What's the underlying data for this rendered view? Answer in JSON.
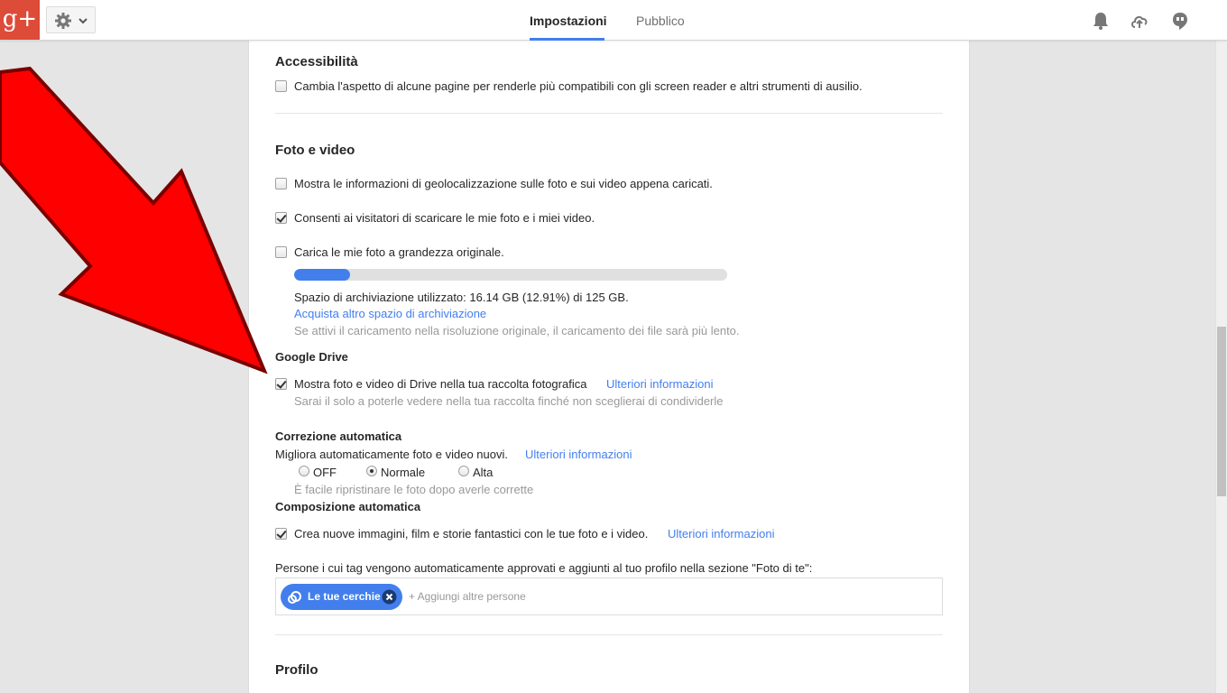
{
  "topbar": {
    "logo": "g+",
    "tabs": [
      {
        "label": "Impostazioni",
        "active": true
      },
      {
        "label": "Pubblico",
        "active": false
      }
    ],
    "icons": [
      "settings-gear-icon",
      "chevron-down-icon",
      "notifications-bell-icon",
      "share-cloud-icon",
      "hangouts-icon"
    ]
  },
  "accessibility": {
    "title": "Accessibilità",
    "option": {
      "label": "Cambia l'aspetto di alcune pagine per renderle più compatibili con gli screen reader e altri strumenti di ausilio.",
      "checked": false
    }
  },
  "photos": {
    "title": "Foto e video",
    "options": [
      {
        "label": "Mostra le informazioni di geolocalizzazione sulle foto e sui video appena caricati.",
        "checked": false
      },
      {
        "label": "Consenti ai visitatori di scaricare le mie foto e i miei video.",
        "checked": true
      },
      {
        "label": "Carica le mie foto a grandezza originale.",
        "checked": false
      }
    ],
    "storage": {
      "used_fraction": 0.1291,
      "text": "Spazio di archiviazione utilizzato: 16.14 GB (12.91%) di 125 GB.",
      "buy_link": "Acquista altro spazio di archiviazione",
      "note": "Se attivi il caricamento nella risoluzione originale, il caricamento dei file sarà più lento."
    }
  },
  "drive": {
    "title": "Google Drive",
    "option": {
      "label": "Mostra foto e video di Drive nella tua raccolta fotografica",
      "checked": true
    },
    "more_link": "Ulteriori informazioni",
    "note": "Sarai il solo a poterle vedere nella tua raccolta finché non sceglierai di condividerle"
  },
  "autofix": {
    "title": "Correzione automatica",
    "description": "Migliora automaticamente foto e video nuovi.",
    "more_link": "Ulteriori informazioni",
    "options": [
      {
        "label": "OFF",
        "selected": false
      },
      {
        "label": "Normale",
        "selected": true
      },
      {
        "label": "Alta",
        "selected": false
      }
    ],
    "note": "È facile ripristinare le foto dopo averle corrette"
  },
  "autoawesome": {
    "title": "Composizione automatica",
    "option": {
      "label": "Crea nuove immagini, film e storie fantastici con le tue foto e i video.",
      "checked": true
    },
    "more_link": "Ulteriori informazioni"
  },
  "tagging": {
    "label": "Persone i cui tag vengono automaticamente approvati e aggiunti al tuo profilo nella sezione \"Foto di te\":",
    "chip": "Le tue cerchie",
    "add_placeholder": "+ Aggiungi altre persone"
  },
  "profile": {
    "title": "Profilo"
  },
  "colors": {
    "brand_red": "#dd4b39",
    "accent_blue": "#427fed",
    "annotation_arrow": "#ff0000"
  }
}
